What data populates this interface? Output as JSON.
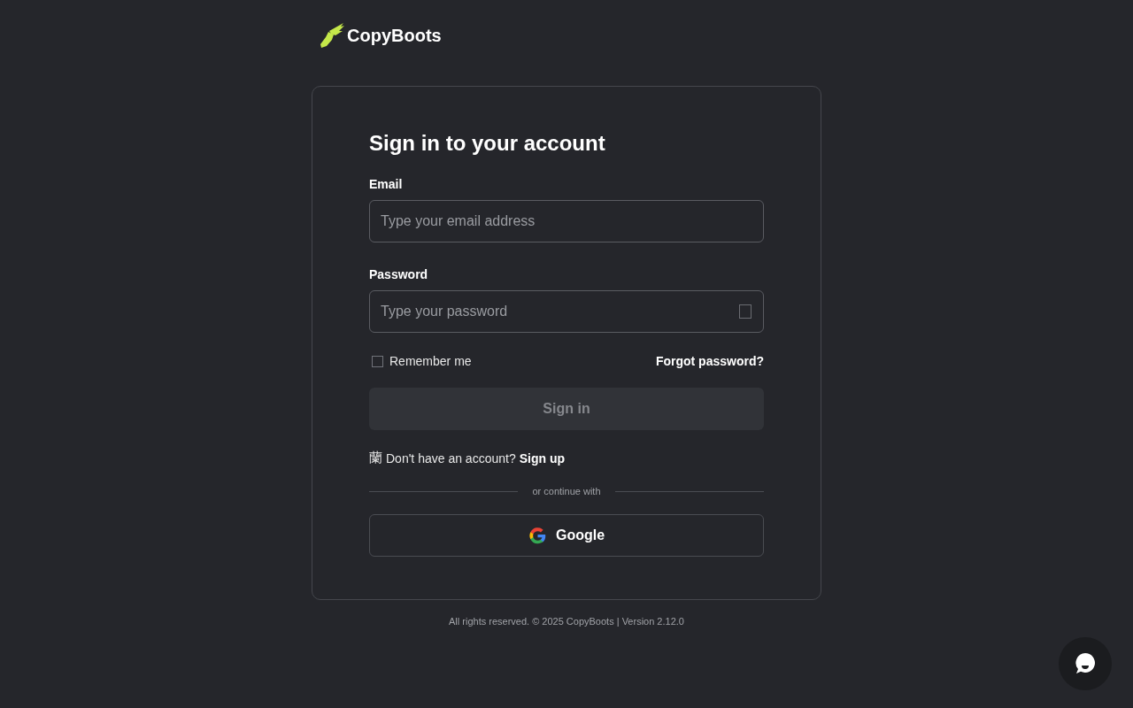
{
  "brand": {
    "name": "CopyBoots"
  },
  "form": {
    "title": "Sign in to your account",
    "email": {
      "label": "Email",
      "placeholder": "Type your email address"
    },
    "password": {
      "label": "Password",
      "placeholder": "Type your password"
    },
    "remember": {
      "label": "Remember me",
      "checked": false
    },
    "forgot": "Forgot password?",
    "submit": {
      "label": "Sign in",
      "disabled": true
    },
    "signup": {
      "glyph": "蘭",
      "prompt": "Don't have an account?",
      "link": "Sign up"
    },
    "divider": "or continue with",
    "google": {
      "label": "Google"
    }
  },
  "footer": "All rights reserved. © 2025 CopyBoots | Version 2.12.0"
}
